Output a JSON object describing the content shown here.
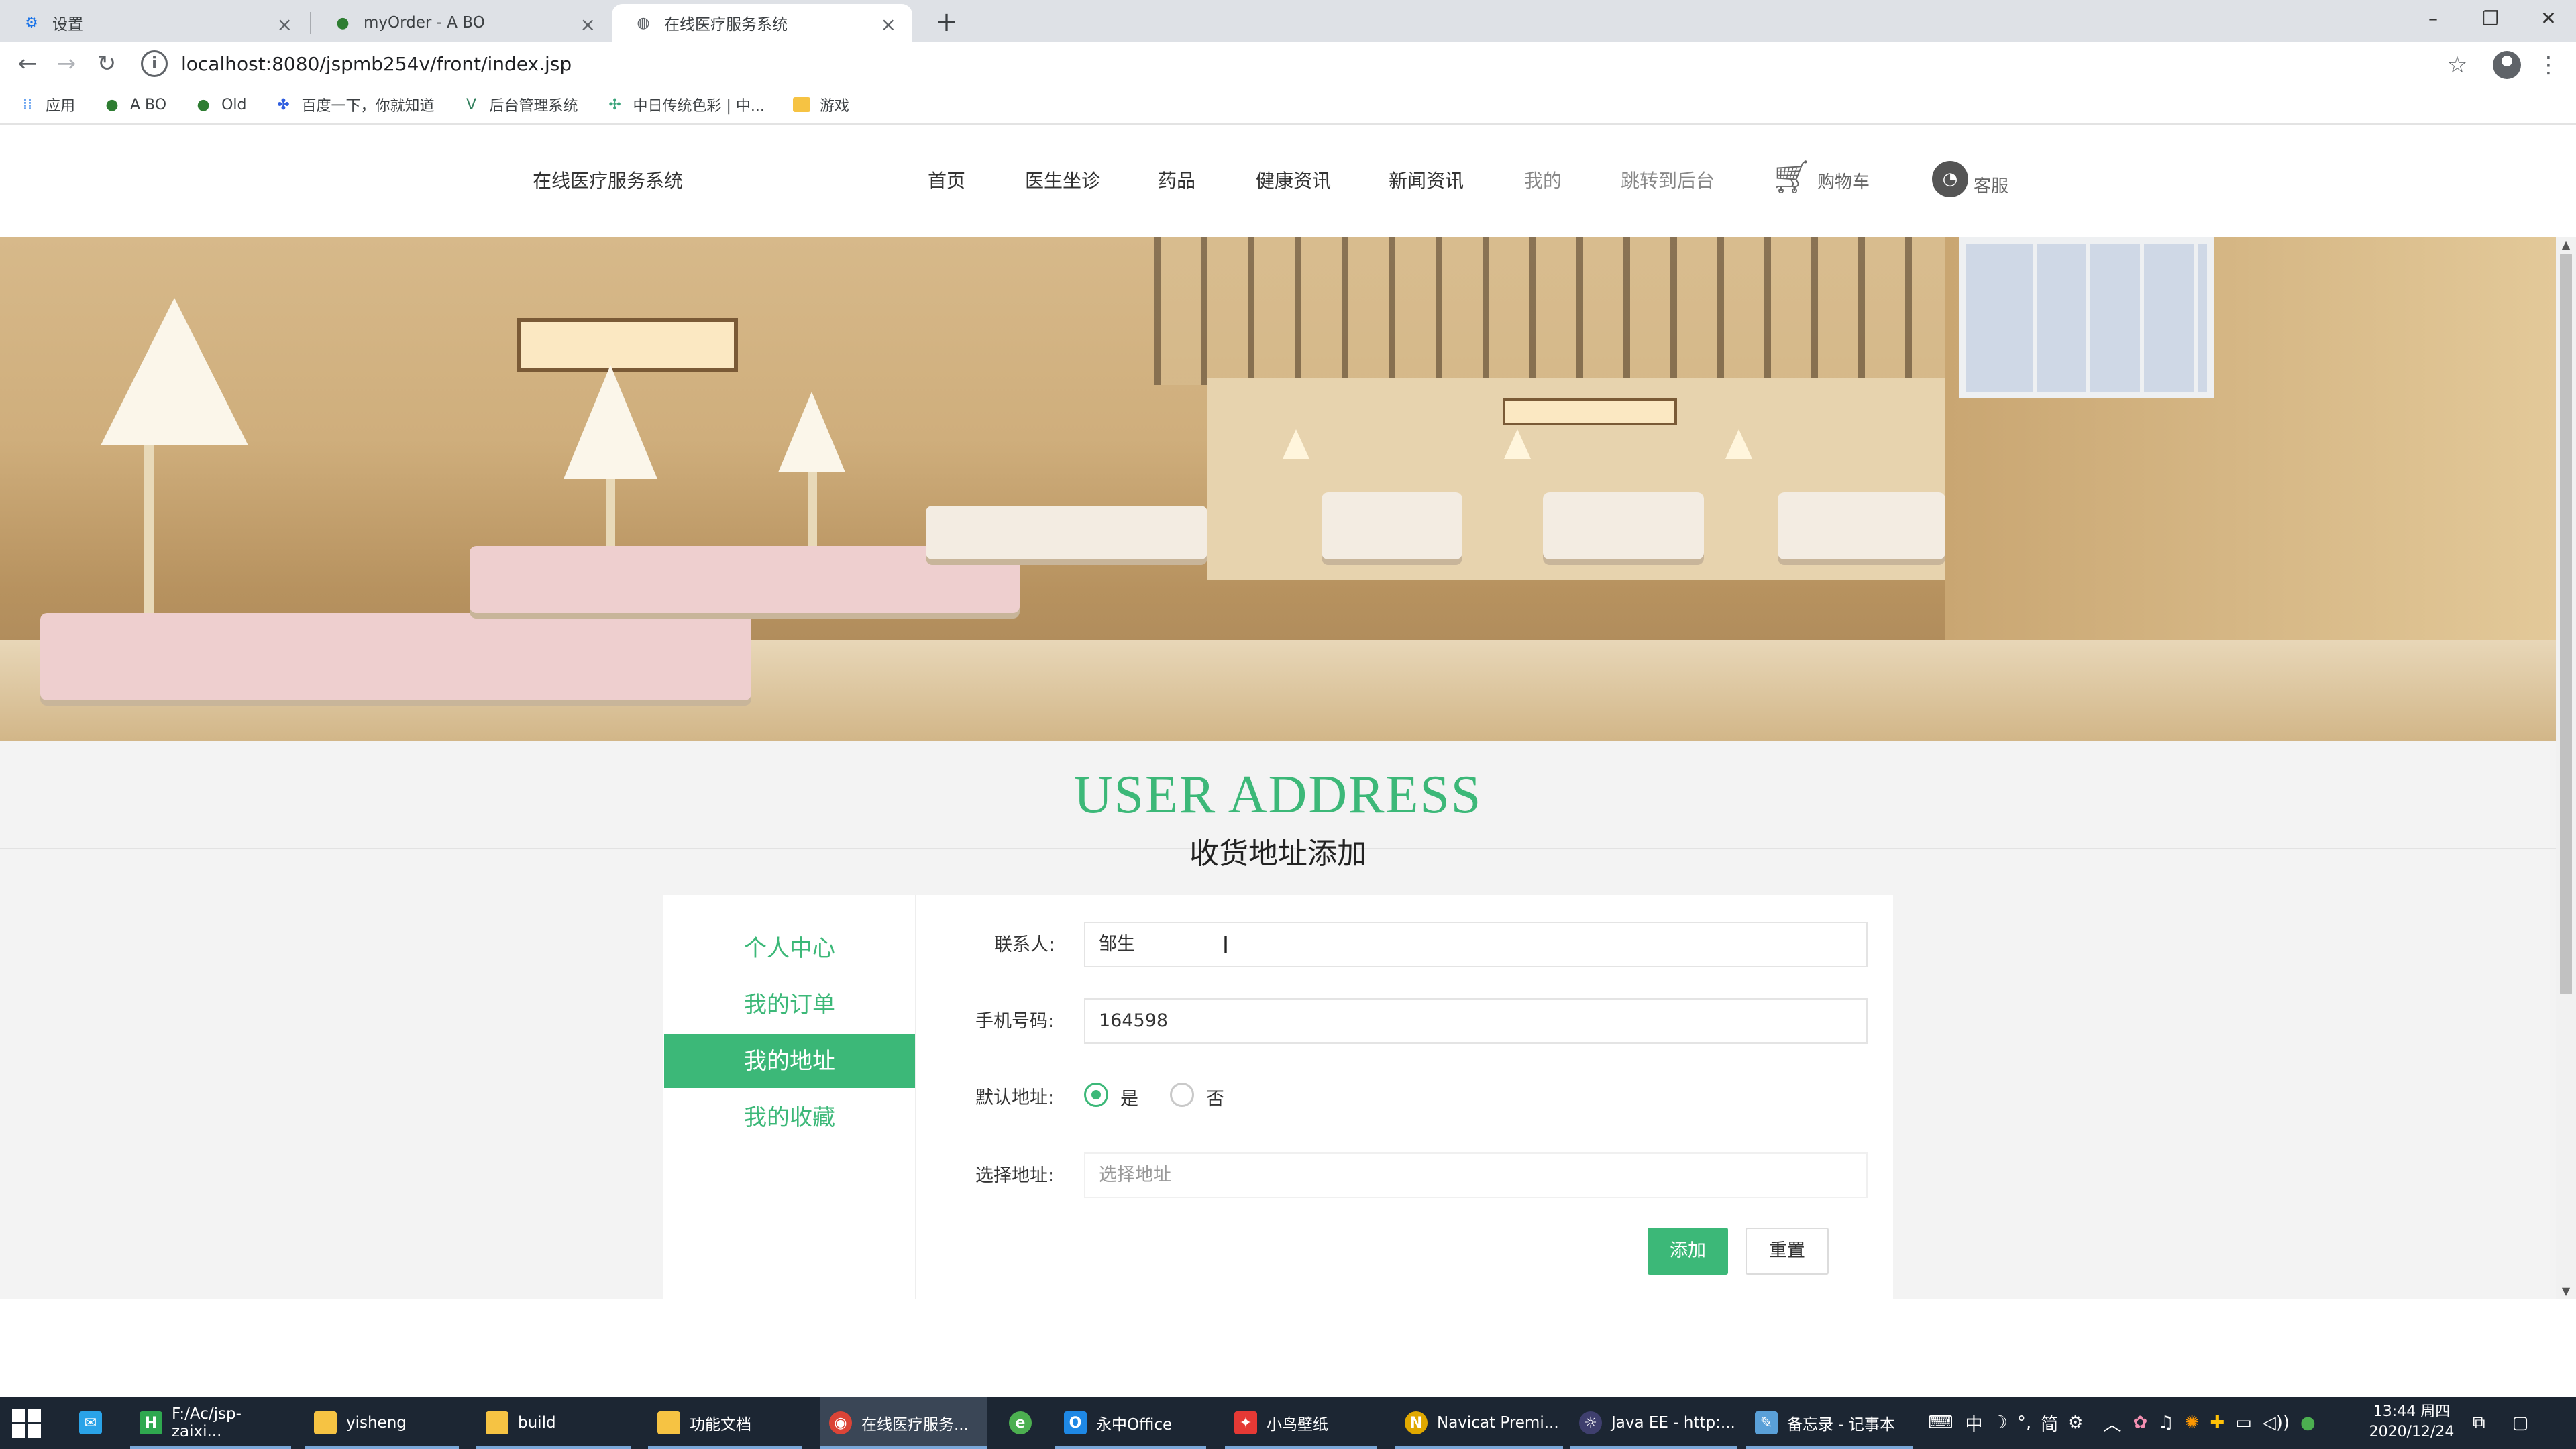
{
  "browser": {
    "tabs": [
      {
        "title": "设置",
        "icon": "gear-icon"
      },
      {
        "title": "myOrder - A BO",
        "icon": "site-icon"
      },
      {
        "title": "在线医疗服务系统",
        "icon": "globe-icon",
        "active": true
      }
    ],
    "url": "localhost:8080/jspmb254v/front/index.jsp",
    "bookmarks": [
      {
        "label": "应用",
        "icon": "apps-icon"
      },
      {
        "label": "A BO",
        "icon": "site-icon"
      },
      {
        "label": "Old",
        "icon": "site-icon"
      },
      {
        "label": "百度一下，你就知道",
        "icon": "baidu-icon"
      },
      {
        "label": "后台管理系统",
        "icon": "vue-icon"
      },
      {
        "label": "中日传统色彩 | 中...",
        "icon": "puzzle-icon"
      },
      {
        "label": "游戏",
        "icon": "folder-icon"
      }
    ]
  },
  "site": {
    "title": "在线医疗服务系统",
    "nav": [
      "首页",
      "医生坐诊",
      "药品",
      "健康资讯",
      "新闻资讯",
      "我的",
      "跳转到后台"
    ],
    "cart_label": "购物车",
    "service_label": "客服"
  },
  "section": {
    "title_en": "USER ADDRESS",
    "title_cn": "收货地址添加"
  },
  "sidebar": {
    "items": [
      {
        "label": "个人中心",
        "active": false
      },
      {
        "label": "我的订单",
        "active": false
      },
      {
        "label": "我的地址",
        "active": true
      },
      {
        "label": "我的收藏",
        "active": false
      }
    ]
  },
  "form": {
    "contact_label": "联系人:",
    "contact_value": "邹生",
    "phone_label": "手机号码:",
    "phone_value": "164598",
    "default_label": "默认地址:",
    "default_yes": "是",
    "default_no": "否",
    "default_selected": "是",
    "address_label": "选择地址:",
    "address_placeholder": "选择地址",
    "add_button": "添加",
    "reset_button": "重置"
  },
  "taskbar": {
    "items": [
      "F:/Ac/jsp-zaixi...",
      "yisheng",
      "build",
      "功能文档",
      "在线医疗服务...",
      "永中Office",
      "小鸟壁纸",
      "Navicat Premi...",
      "Java EE - http:...",
      "备忘录 - 记事本"
    ],
    "ime": "中",
    "ime_mode": "简",
    "time": "13:44 周四",
    "date": "2020/12/24"
  },
  "colors": {
    "accent": "#3cb878",
    "taskbar": "#1c2633"
  }
}
